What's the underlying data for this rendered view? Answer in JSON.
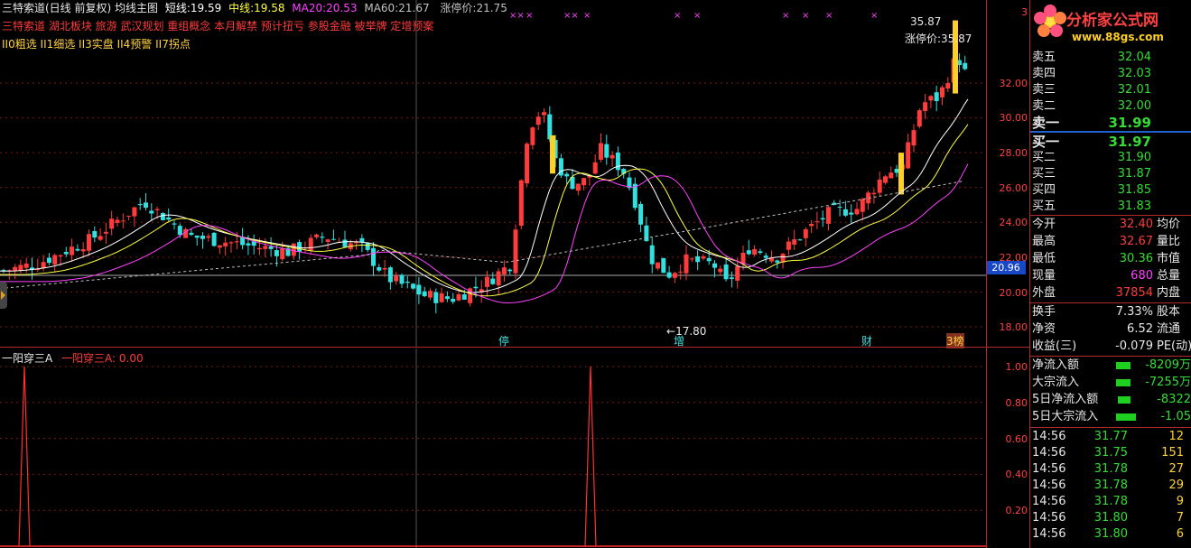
{
  "header": {
    "title": "三特索道(日线 前复权) 均线主图",
    "ma_short_label": "短线:",
    "ma_short_value": "19.59",
    "ma_mid_label": "中线:",
    "ma_mid_value": "19.58",
    "ma20_label": "MA20:",
    "ma20_value": "20.53",
    "ma60_label": "MA60:",
    "ma60_value": "21.67",
    "limit_label": "涨停价:",
    "limit_value": "21.75",
    "concepts": "三特索道 湖北板块 旅游 武汉规划 重组概念 本月解禁 预计扭亏 参股金融 被举牌 定增预案",
    "selectors": "II0粗选 II1细选 II3实盘 II4预警 II7拐点"
  },
  "main_axis": {
    "labels": [
      "32.00",
      "30.00",
      "28.00",
      "26.00",
      "24.00",
      "22.00",
      "20.00",
      "18.00"
    ],
    "top_partial": "3",
    "current_price_tag": "20.96"
  },
  "annotations": {
    "peak_price": "35.87",
    "peak_limit": "涨停价:35.87",
    "low_price": "17.80",
    "event_markers": [
      "停",
      "增",
      "财",
      "3榜"
    ]
  },
  "sub_chart": {
    "title": "一阳穿三A",
    "title_value_label": "一阳穿三A: 0.00",
    "axis_labels": [
      "1.00",
      "0.80",
      "0.60",
      "0.40",
      "0.20"
    ]
  },
  "logo": {
    "text": "分析家公式网",
    "url": "www.88gs.com"
  },
  "order_book": {
    "asks": [
      {
        "label": "卖五",
        "price": "32.04"
      },
      {
        "label": "卖四",
        "price": "32.03"
      },
      {
        "label": "卖三",
        "price": "32.01"
      },
      {
        "label": "卖二",
        "price": "32.00"
      },
      {
        "label": "卖一",
        "price": "31.99"
      }
    ],
    "bids": [
      {
        "label": "买一",
        "price": "31.97"
      },
      {
        "label": "买二",
        "price": "31.90"
      },
      {
        "label": "买三",
        "price": "31.87"
      },
      {
        "label": "买四",
        "price": "31.85"
      },
      {
        "label": "买五",
        "price": "31.83"
      }
    ]
  },
  "quote": {
    "open_label": "今开",
    "open": "32.40",
    "avg_label": "均价",
    "high_label": "最高",
    "high": "32.67",
    "vol_ratio_label": "量比",
    "low_label": "最低",
    "low": "30.36",
    "mcap_label": "市值",
    "volume_label": "现量",
    "volume": "680",
    "total_label": "总量",
    "outer_label": "外盘",
    "outer": "37854",
    "inner_label": "内盘",
    "turnover_label": "换手",
    "turnover": "7.33%",
    "equity_label": "股本",
    "nav_label": "净资",
    "nav": "6.52",
    "float_label": "流通",
    "eps_label": "收益(三)",
    "eps": "-0.079",
    "pe_label": "PE(动)"
  },
  "flows": [
    {
      "label": "净流入额",
      "value": "-8209万"
    },
    {
      "label": "大宗流入",
      "value": "-7255万"
    },
    {
      "label": "5日净流入额",
      "value": "-8322"
    },
    {
      "label": "5日大宗流入",
      "value": "-1.05"
    }
  ],
  "ticks": [
    {
      "time": "14:56",
      "price": "31.77",
      "vol": "12"
    },
    {
      "time": "14:56",
      "price": "31.75",
      "vol": "151"
    },
    {
      "time": "14:56",
      "price": "31.78",
      "vol": "27"
    },
    {
      "time": "14:56",
      "price": "31.78",
      "vol": "29"
    },
    {
      "time": "14:56",
      "price": "31.78",
      "vol": "9"
    },
    {
      "time": "14:56",
      "price": "31.80",
      "vol": "7"
    },
    {
      "time": "14:56",
      "price": "31.80",
      "vol": "6"
    }
  ],
  "colors": {
    "up": "#ff3b3b",
    "down": "#33e0e0",
    "ma_short": "#ffffff",
    "ma_mid": "#ffff40",
    "ma20": "#ff40ff",
    "ma60": "#c0c0c0",
    "grid": "#8a1f1f"
  }
}
